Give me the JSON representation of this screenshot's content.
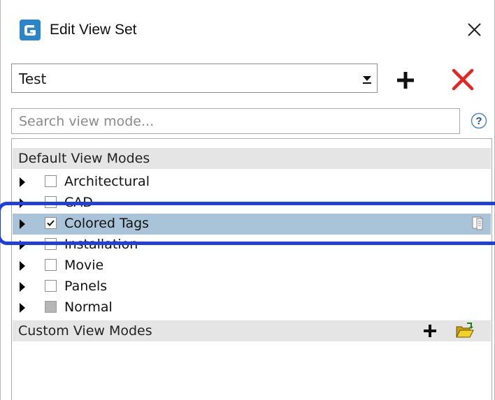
{
  "window": {
    "title": "Edit View Set",
    "icon": "app-logo-icon",
    "close_icon": "close-icon"
  },
  "view_set": {
    "selected": "Test",
    "add_icon": "plus-icon",
    "delete_icon": "red-x-icon",
    "delete_color": "#e52521"
  },
  "search": {
    "placeholder": "Search view mode...",
    "value": "",
    "help_label": "?"
  },
  "default_section": {
    "title": "Default View Modes",
    "items": [
      {
        "label": "Architectural",
        "checked": false,
        "state": "unchecked"
      },
      {
        "label": "CAD",
        "checked": false,
        "state": "unchecked"
      },
      {
        "label": "Colored Tags",
        "checked": true,
        "state": "checked",
        "selected": true
      },
      {
        "label": "Installation",
        "checked": false,
        "state": "unchecked"
      },
      {
        "label": "Movie",
        "checked": false,
        "state": "unchecked"
      },
      {
        "label": "Panels",
        "checked": false,
        "state": "unchecked"
      },
      {
        "label": "Normal",
        "checked": false,
        "state": "indeterminate"
      }
    ]
  },
  "custom_section": {
    "title": "Custom View Modes",
    "add_icon": "plus-icon",
    "open_icon": "open-folder-icon"
  },
  "colors": {
    "selection": "#a9c4d8",
    "section_header": "#e5e5e5",
    "highlight_annotation": "#1f3fe0"
  }
}
